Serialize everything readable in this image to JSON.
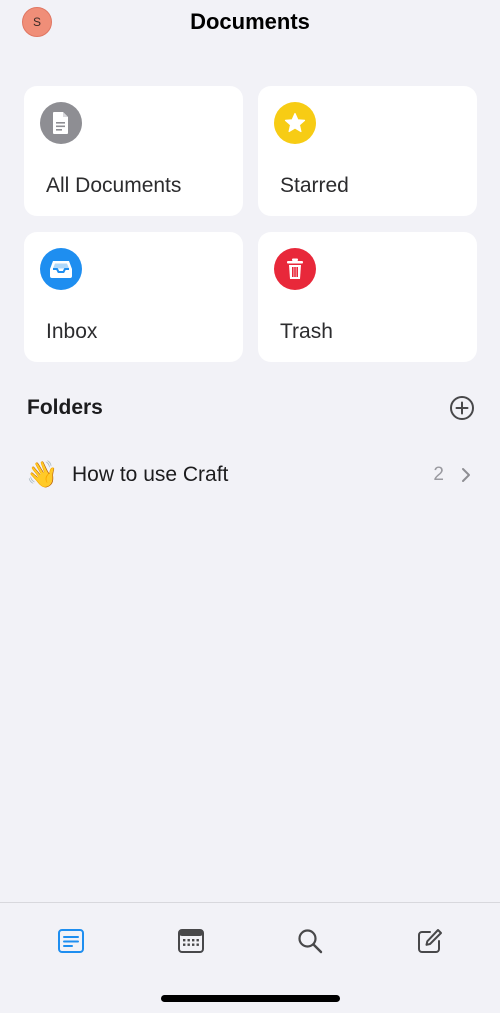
{
  "header": {
    "avatar_initial": "S",
    "title": "Documents"
  },
  "cards": [
    {
      "label": "All Documents",
      "icon": "document-icon",
      "color": "#8e8e93"
    },
    {
      "label": "Starred",
      "icon": "star-icon",
      "color": "#f7cc14"
    },
    {
      "label": "Inbox",
      "icon": "inbox-tray-icon",
      "color": "#1e8ef0"
    },
    {
      "label": "Trash",
      "icon": "trash-icon",
      "color": "#e8283a"
    }
  ],
  "folders": {
    "title": "Folders",
    "items": [
      {
        "emoji": "👋",
        "name": "How to use Craft",
        "count": "2"
      }
    ]
  },
  "tabbar": {
    "tabs": [
      {
        "icon": "documents-list-icon",
        "active": true,
        "color": "#1e8ef0"
      },
      {
        "icon": "calendar-icon",
        "active": false,
        "color": "#48484a"
      },
      {
        "icon": "search-icon",
        "active": false,
        "color": "#48484a"
      },
      {
        "icon": "compose-icon",
        "active": false,
        "color": "#48484a"
      }
    ]
  }
}
